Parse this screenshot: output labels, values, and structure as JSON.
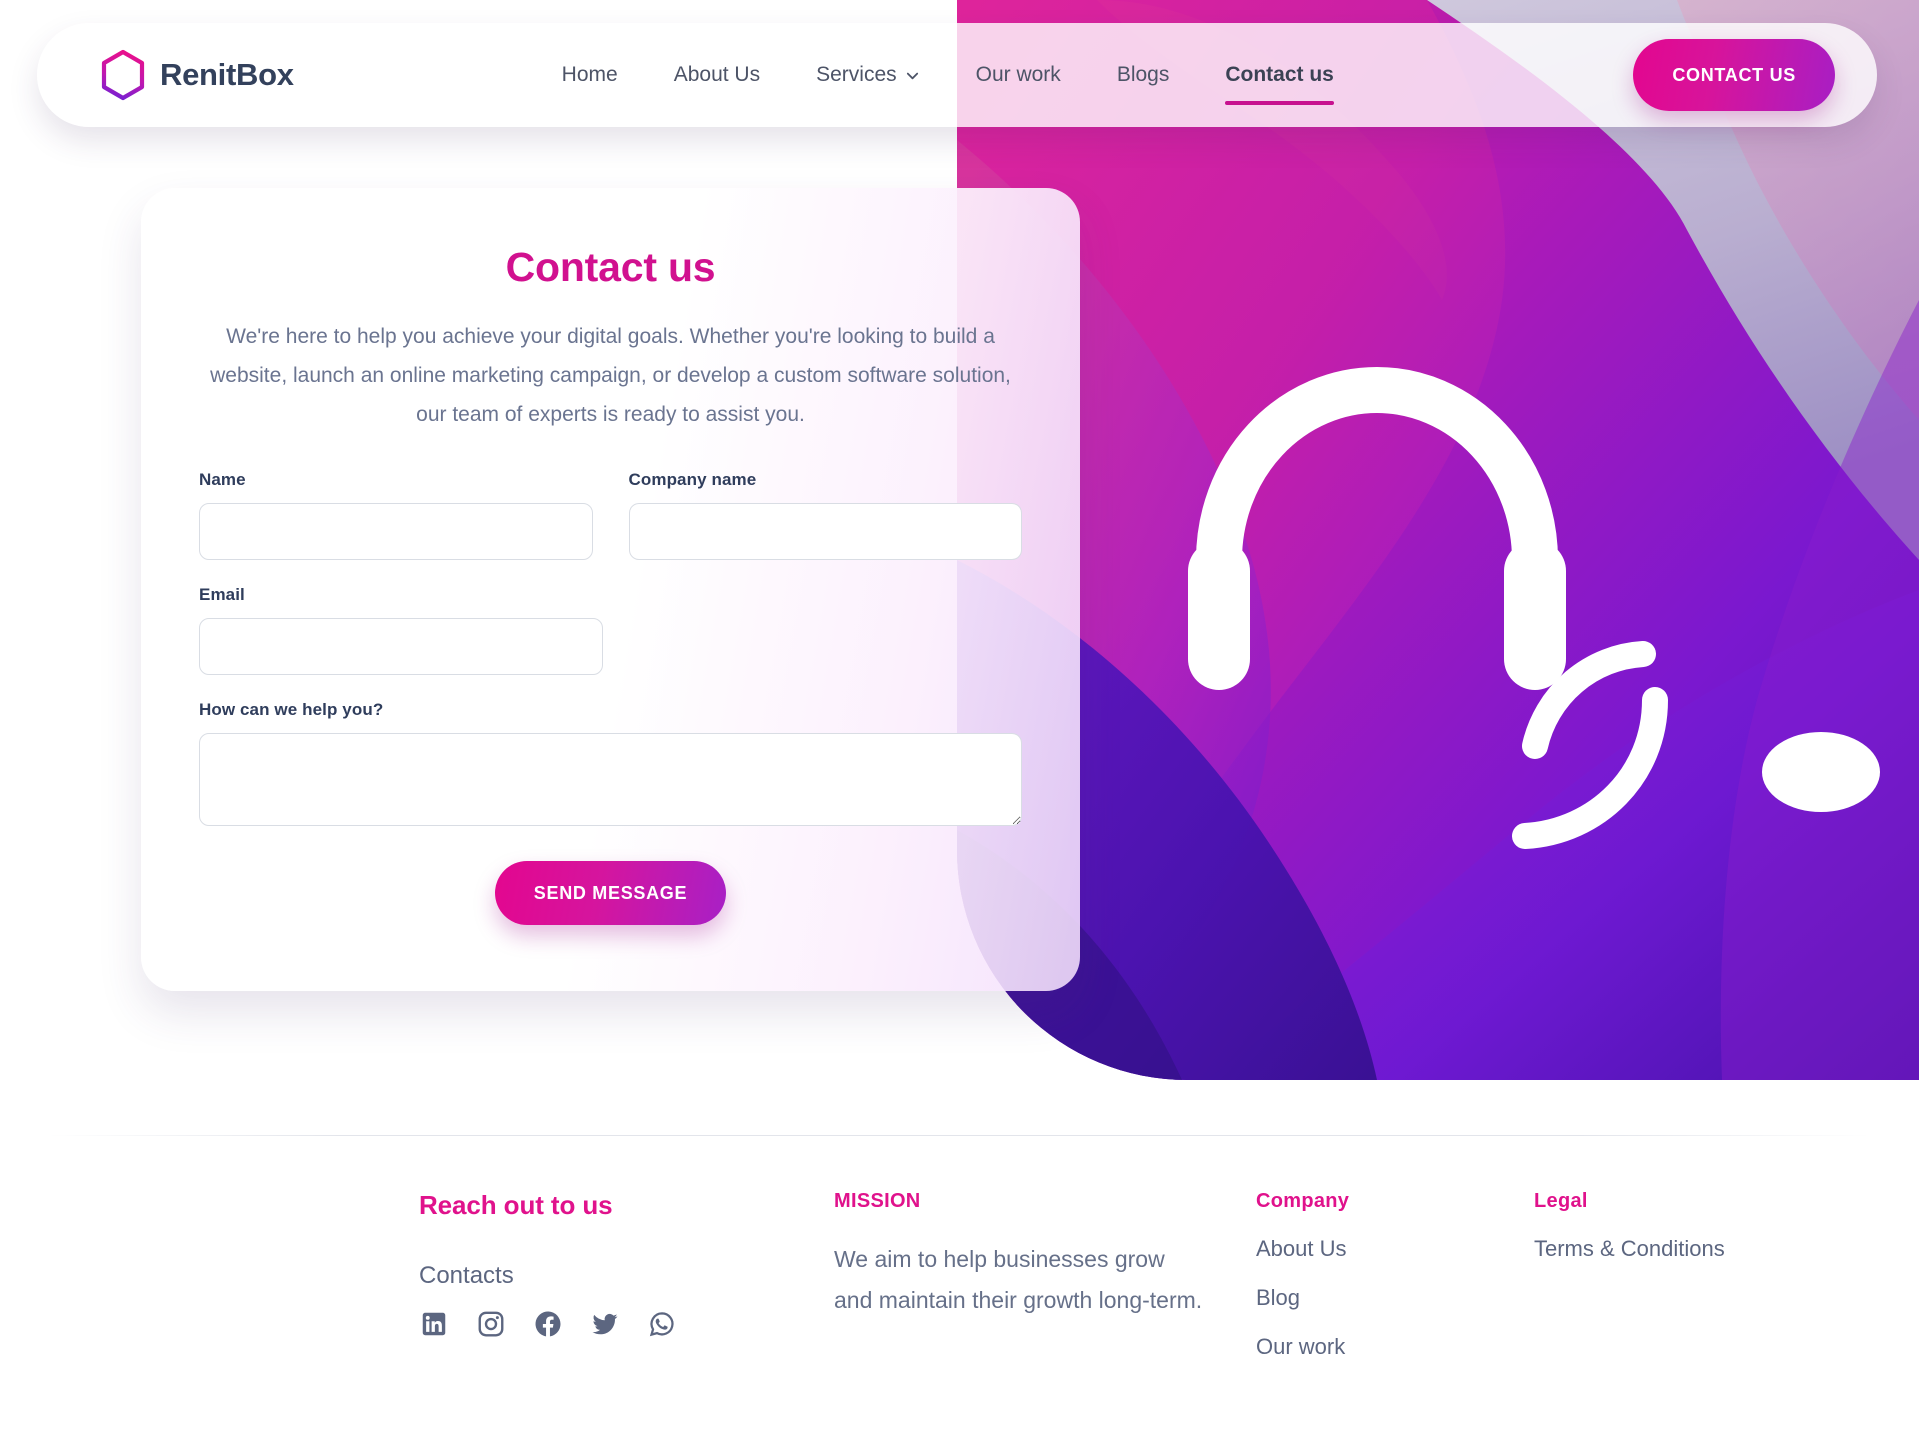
{
  "brand": {
    "name": "RenitBox",
    "logo_icon": "hexagon-logo-icon"
  },
  "nav": {
    "items": [
      {
        "label": "Home",
        "active": false,
        "caret": false
      },
      {
        "label": "About Us",
        "active": false,
        "caret": false
      },
      {
        "label": "Services",
        "active": false,
        "caret": true
      },
      {
        "label": "Our work",
        "active": false,
        "caret": false
      },
      {
        "label": "Blogs",
        "active": false,
        "caret": false
      },
      {
        "label": "Contact us",
        "active": true,
        "caret": false
      }
    ],
    "cta_label": "CONTACT US"
  },
  "contact": {
    "title": "Contact us",
    "subtitle": "We're here to help you achieve your digital goals. Whether you're looking to build a website, launch an online marketing campaign, or develop a custom software solution, our team of experts is ready to assist you.",
    "fields": {
      "name_label": "Name",
      "name_value": "",
      "name_placeholder": "",
      "company_label": "Company name",
      "company_value": "",
      "company_placeholder": "",
      "email_label": "Email",
      "email_value": "",
      "email_placeholder": "",
      "message_label": "How can we help you?",
      "message_value": "",
      "message_placeholder": ""
    },
    "submit_label": "SEND MESSAGE"
  },
  "hero": {
    "illustration": "customer-support-headset-illustration"
  },
  "footer": {
    "reach": {
      "heading": "Reach out to us",
      "contacts_label": "Contacts",
      "socials": [
        {
          "name": "linkedin-icon",
          "label": "LinkedIn"
        },
        {
          "name": "instagram-icon",
          "label": "Instagram"
        },
        {
          "name": "facebook-icon",
          "label": "Facebook"
        },
        {
          "name": "twitter-icon",
          "label": "Twitter"
        },
        {
          "name": "whatsapp-icon",
          "label": "WhatsApp"
        }
      ]
    },
    "mission": {
      "heading": "MISSION",
      "text": "We aim to help businesses grow and maintain their growth long-term."
    },
    "company": {
      "heading": "Company",
      "links": [
        "About Us",
        "Blog",
        "Our work"
      ]
    },
    "legal": {
      "heading": "Legal",
      "links": [
        "Terms & Conditions"
      ]
    }
  },
  "colors": {
    "accent_pink": "#e0128c",
    "accent_magenta": "#c7118f",
    "accent_purple": "#a820c6",
    "text_slate": "#5c6680",
    "text_navy": "#2f3d5c"
  }
}
